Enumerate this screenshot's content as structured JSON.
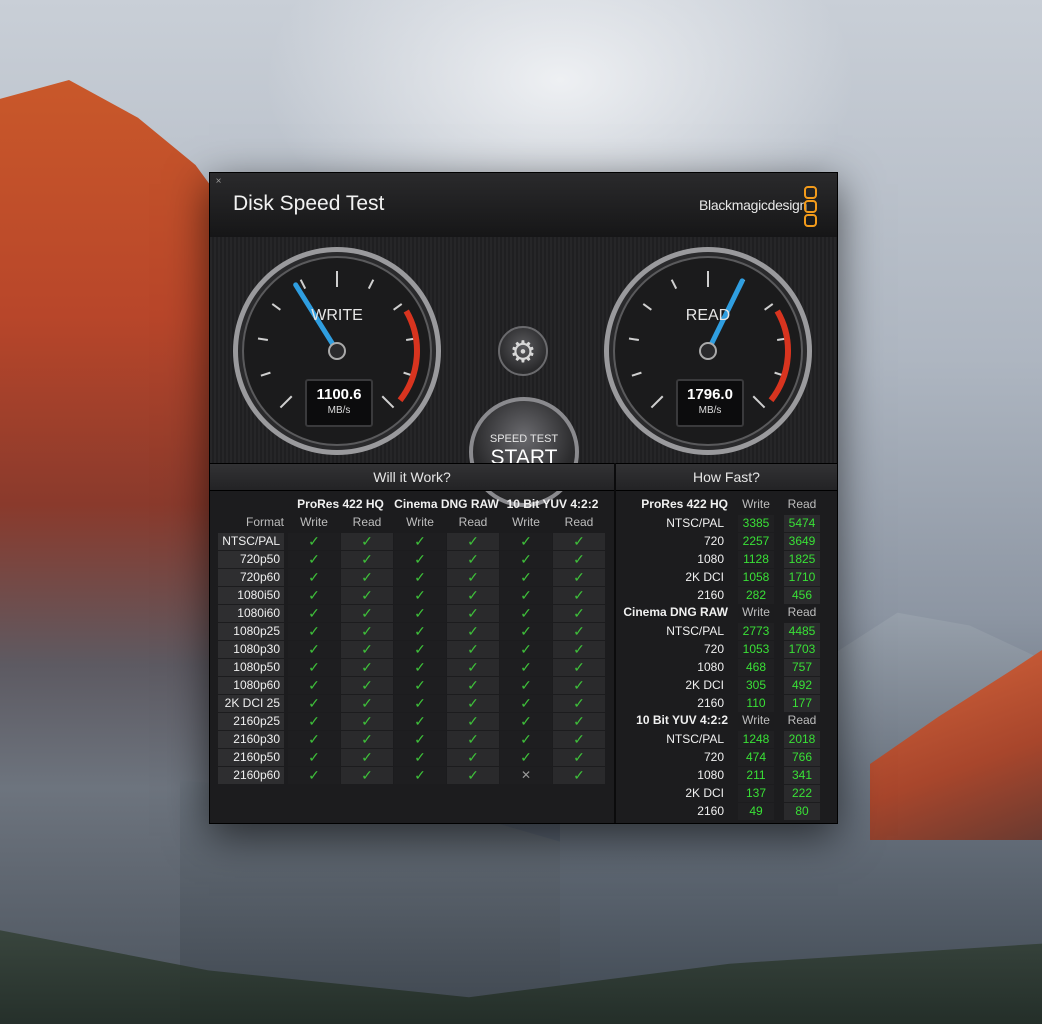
{
  "app": {
    "title": "Disk Speed Test",
    "brand": "Blackmagicdesign",
    "close_glyph": "×"
  },
  "gauges": {
    "write": {
      "label": "WRITE",
      "value": "1100.6",
      "unit": "MB/s"
    },
    "read": {
      "label": "READ",
      "value": "1796.0",
      "unit": "MB/s"
    }
  },
  "controls": {
    "settings_icon": "gear-icon",
    "start_top": "SPEED TEST",
    "start_bottom": "START"
  },
  "will_it_work": {
    "title": "Will it Work?",
    "groups": [
      "ProRes 422 HQ",
      "Cinema DNG RAW",
      "10 Bit YUV 4:2:2"
    ],
    "format_label": "Format",
    "sub": [
      "Write",
      "Read",
      "Write",
      "Read",
      "Write",
      "Read"
    ],
    "rows": [
      {
        "format": "NTSC/PAL",
        "cells": [
          1,
          1,
          1,
          1,
          1,
          1
        ]
      },
      {
        "format": "720p50",
        "cells": [
          1,
          1,
          1,
          1,
          1,
          1
        ]
      },
      {
        "format": "720p60",
        "cells": [
          1,
          1,
          1,
          1,
          1,
          1
        ]
      },
      {
        "format": "1080i50",
        "cells": [
          1,
          1,
          1,
          1,
          1,
          1
        ]
      },
      {
        "format": "1080i60",
        "cells": [
          1,
          1,
          1,
          1,
          1,
          1
        ]
      },
      {
        "format": "1080p25",
        "cells": [
          1,
          1,
          1,
          1,
          1,
          1
        ]
      },
      {
        "format": "1080p30",
        "cells": [
          1,
          1,
          1,
          1,
          1,
          1
        ]
      },
      {
        "format": "1080p50",
        "cells": [
          1,
          1,
          1,
          1,
          1,
          1
        ]
      },
      {
        "format": "1080p60",
        "cells": [
          1,
          1,
          1,
          1,
          1,
          1
        ]
      },
      {
        "format": "2K DCI 25",
        "cells": [
          1,
          1,
          1,
          1,
          1,
          1
        ]
      },
      {
        "format": "2160p25",
        "cells": [
          1,
          1,
          1,
          1,
          1,
          1
        ]
      },
      {
        "format": "2160p30",
        "cells": [
          1,
          1,
          1,
          1,
          1,
          1
        ]
      },
      {
        "format": "2160p50",
        "cells": [
          1,
          1,
          1,
          1,
          1,
          1
        ]
      },
      {
        "format": "2160p60",
        "cells": [
          1,
          1,
          1,
          1,
          0,
          1
        ]
      }
    ],
    "ok_glyph": "✓",
    "fail_glyph": "✕"
  },
  "how_fast": {
    "title": "How Fast?",
    "col_write": "Write",
    "col_read": "Read",
    "groups": [
      {
        "name": "ProRes 422 HQ",
        "rows": [
          {
            "label": "NTSC/PAL",
            "write": "3385",
            "read": "5474"
          },
          {
            "label": "720",
            "write": "2257",
            "read": "3649"
          },
          {
            "label": "1080",
            "write": "1128",
            "read": "1825"
          },
          {
            "label": "2K DCI",
            "write": "1058",
            "read": "1710"
          },
          {
            "label": "2160",
            "write": "282",
            "read": "456"
          }
        ]
      },
      {
        "name": "Cinema DNG RAW",
        "rows": [
          {
            "label": "NTSC/PAL",
            "write": "2773",
            "read": "4485"
          },
          {
            "label": "720",
            "write": "1053",
            "read": "1703"
          },
          {
            "label": "1080",
            "write": "468",
            "read": "757"
          },
          {
            "label": "2K DCI",
            "write": "305",
            "read": "492"
          },
          {
            "label": "2160",
            "write": "110",
            "read": "177"
          }
        ]
      },
      {
        "name": "10 Bit YUV 4:2:2",
        "rows": [
          {
            "label": "NTSC/PAL",
            "write": "1248",
            "read": "2018"
          },
          {
            "label": "720",
            "write": "474",
            "read": "766"
          },
          {
            "label": "1080",
            "write": "211",
            "read": "341"
          },
          {
            "label": "2K DCI",
            "write": "137",
            "read": "222"
          },
          {
            "label": "2160",
            "write": "49",
            "read": "80"
          }
        ]
      }
    ]
  },
  "colors": {
    "accent_needle": "#2f9ee0",
    "ok_green": "#3ec03a",
    "value_green": "#39e036",
    "brand_orange": "#f39b1b"
  }
}
